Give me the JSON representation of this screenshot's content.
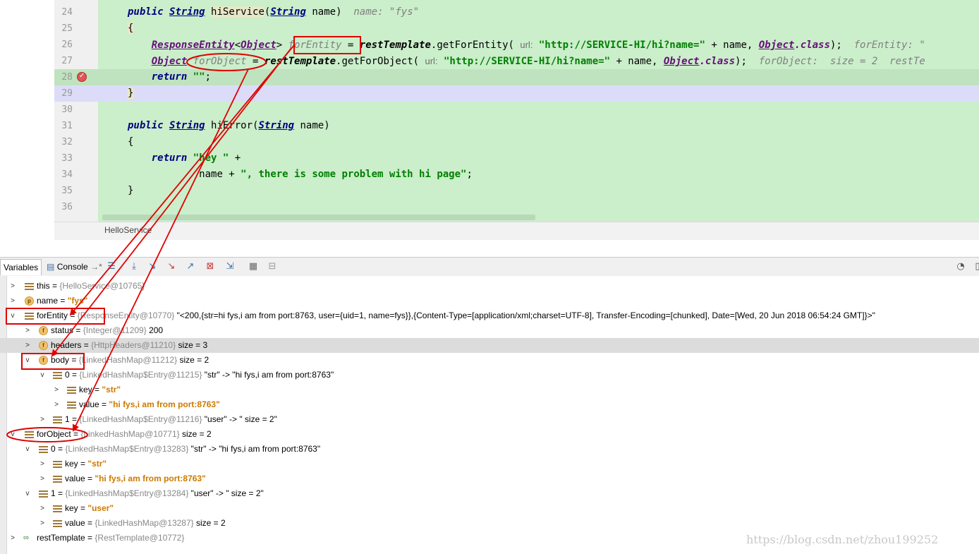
{
  "editor": {
    "lines": [
      {
        "n": "24"
      },
      {
        "n": "25"
      },
      {
        "n": "26"
      },
      {
        "n": "27"
      },
      {
        "n": "28"
      },
      {
        "n": "29"
      },
      {
        "n": "30"
      },
      {
        "n": "31"
      },
      {
        "n": "32"
      },
      {
        "n": "33"
      },
      {
        "n": "34"
      },
      {
        "n": "35"
      },
      {
        "n": "36"
      }
    ],
    "l24": {
      "kw1": "public",
      "type": "String",
      "method": "hiService",
      "ptype": "String",
      "param": "name",
      "hint": "name: \"fys\""
    },
    "l26": {
      "type1": "ResponseEntity",
      "type2": "Object",
      "var": "forEntity",
      "eq": " = ",
      "obj": "restTemplate",
      "call": ".getForEntity(",
      "plabel": "url:",
      "url": "\"http://SERVICE-HI/hi?name=\"",
      "plus": " + name, ",
      "cls": "Object",
      "clsk": ".class",
      "end": ");",
      "hint": "forEntity: \""
    },
    "l27": {
      "type": "Object",
      "var": "forObject",
      "eq": " = ",
      "obj": "restTemplate",
      "call": ".getForObject(",
      "plabel": "url:",
      "url": "\"http://SERVICE-HI/hi?name=\"",
      "plus": " + name, ",
      "cls": "Object",
      "clsk": ".class",
      "end": ");",
      "hint": "forObject:  size = 2  restTe"
    },
    "l28": {
      "kw": "return",
      "str": "\"\"",
      "end": ";"
    },
    "l31": {
      "kw1": "public",
      "type": "String",
      "method": "hiError",
      "ptype": "String",
      "param": "name"
    },
    "l33": {
      "kw": "return",
      "str": "\"hey \"",
      "plus": " +"
    },
    "l34": {
      "name": "name + ",
      "str": "\", there is some problem with hi page\"",
      "end": ";"
    },
    "brace_open": "{",
    "brace_close": "}",
    "filename": "HelloService"
  },
  "toolbar": {
    "variables": "Variables",
    "console": "Console",
    "console_suffix": "→*"
  },
  "vars": [
    {
      "name": "this",
      "eq": " = ",
      "val": "{HelloService@10765}"
    },
    {
      "name": "name",
      "eq": " = ",
      "val": "\"fys\""
    },
    {
      "name": "forEntity",
      "eq": " = ",
      "val": "{ResponseEntity@10770}",
      "extra": " \"<200,{str=hi fys,i am from port:8763, user={uid=1, name=fys}},{Content-Type=[application/xml;charset=UTF-8], Transfer-Encoding=[chunked], Date=[Wed, 20 Jun 2018 06:54:24 GMT]}>\""
    },
    {
      "name": "status",
      "eq": " = ",
      "val": "{Integer@11209}",
      "extra": " 200"
    },
    {
      "name": "headers",
      "eq": " = ",
      "val": "{HttpHeaders@11210}",
      "extra": "  size = 3"
    },
    {
      "name": "body",
      "eq": " = ",
      "val": "{LinkedHashMap@11212}",
      "extra": "  size = 2"
    },
    {
      "name": "0",
      "eq": " = ",
      "val": "{LinkedHashMap$Entry@11215}",
      "extra": " \"str\" -> \"hi fys,i am from port:8763\""
    },
    {
      "name": "key",
      "eq": " = ",
      "val": "\"str\""
    },
    {
      "name": "value",
      "eq": " = ",
      "val": "\"hi fys,i am from port:8763\""
    },
    {
      "name": "1",
      "eq": " = ",
      "val": "{LinkedHashMap$Entry@11216}",
      "extra": " \"user\" -> \" size = 2\""
    },
    {
      "name": "forObject",
      "eq": " = ",
      "val": "{LinkedHashMap@10771}",
      "extra": "  size = 2"
    },
    {
      "name": "0",
      "eq": " = ",
      "val": "{LinkedHashMap$Entry@13283}",
      "extra": " \"str\" -> \"hi fys,i am from port:8763\""
    },
    {
      "name": "key",
      "eq": " = ",
      "val": "\"str\""
    },
    {
      "name": "value",
      "eq": " = ",
      "val": "\"hi fys,i am from port:8763\""
    },
    {
      "name": "1",
      "eq": " = ",
      "val": "{LinkedHashMap$Entry@13284}",
      "extra": " \"user\" -> \" size = 2\""
    },
    {
      "name": "key",
      "eq": " = ",
      "val": "\"user\""
    },
    {
      "name": "value",
      "eq": " = ",
      "val": "{LinkedHashMap@13287}",
      "extra": "  size = 2"
    },
    {
      "name": "restTemplate",
      "eq": " = ",
      "val": "{RestTemplate@10772}"
    }
  ],
  "watermark": "https://blog.csdn.net/zhou199252",
  "colors": {
    "annotation": "#e00000",
    "editor_bg": "#cbeecb",
    "selection": "#dcdcdc"
  }
}
